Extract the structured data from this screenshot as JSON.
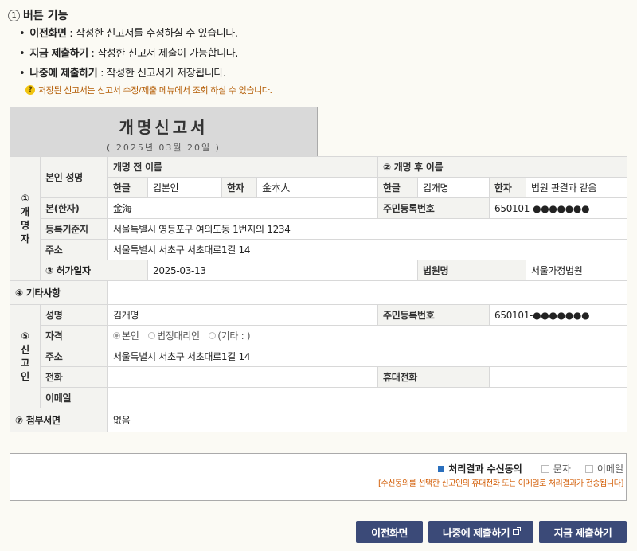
{
  "guide": {
    "number": "1",
    "title": "버튼 기능",
    "items": [
      {
        "label": "이전화면",
        "desc": ": 작성한 신고서를 수정하실 수 있습니다."
      },
      {
        "label": "지금 제출하기",
        "desc": ": 작성한 신고서 제출이 가능합니다."
      },
      {
        "label": "나중에 제출하기",
        "desc": ": 작성한 신고서가 저장됩니다."
      }
    ],
    "note": "저장된 신고서는 신고서 수정/제출 메뉴에서 조회 하실 수 있습니다."
  },
  "form": {
    "title": "개명신고서",
    "date": "( 2025년  03월  20일 )",
    "sections": {
      "person": "① 개 명 자",
      "permit_date": "③ 허가일자",
      "etc": "④ 기타사항",
      "reporter": "⑤ 신 고 인",
      "attachments": "⑦ 첨부서면"
    },
    "person": {
      "self_name_label": "본인 성명",
      "before_label": "개명 전 이름",
      "after_label": "② 개명 후 이름",
      "hangul_label": "한글",
      "hanja_label": "한자",
      "before_hangul": "김본인",
      "before_hanja": "金本人",
      "after_hangul": "김개명",
      "after_hanja": "법원 판결과 같음",
      "origin_label": "본(한자)",
      "origin_value": "金海",
      "rrn_label": "주민등록번호",
      "rrn_value": "650101-●●●●●●●",
      "register_label": "등록기준지",
      "register_value": "서울특별시 영등포구 여의도동 1번지의 1234",
      "address_label": "주소",
      "address_value": "서울특별시 서초구 서초대로1길 14"
    },
    "permit": {
      "date_value": "2025-03-13",
      "court_label": "법원명",
      "court_value": "서울가정법원"
    },
    "etc_value": "",
    "reporter": {
      "name_label": "성명",
      "name_value": "김개명",
      "rrn_label": "주민등록번호",
      "rrn_value": "650101-●●●●●●●",
      "qual_label": "자격",
      "qual_options": [
        "본인",
        "법정대리인",
        "(기타 : )"
      ],
      "address_label": "주소",
      "address_value": "서울특별시 서초구 서초대로1길 14",
      "phone_label": "전화",
      "phone_value": "",
      "mobile_label": "휴대전화",
      "mobile_value": "",
      "email_label": "이메일",
      "email_value": ""
    },
    "attachments_value": "없음"
  },
  "consent": {
    "label": "처리결과 수신동의",
    "opt_sms": "문자",
    "opt_email": "이메일",
    "note": "[수신동의를 선택한 신고인의 휴대전화 또는 이메일로 처리결과가 전송됩니다]"
  },
  "buttons": {
    "prev": "이전화면",
    "later": "나중에 제출하기",
    "now": "지금 제출하기"
  },
  "colors": {
    "button_bg": "#3b4a78",
    "note_orange": "#b35a00",
    "consent_note": "#d25a00",
    "accent_blue": "#2a6fbd"
  }
}
